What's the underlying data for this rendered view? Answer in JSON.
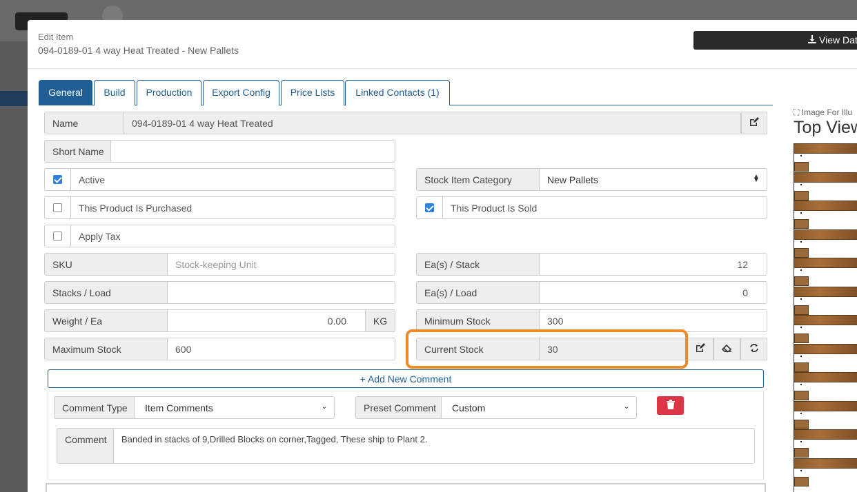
{
  "modal": {
    "subtitle": "Edit Item",
    "title": "094-0189-01 4 way Heat Treated - New Pallets",
    "view_button": "View Dat"
  },
  "tabs": [
    {
      "label": "General",
      "active": true
    },
    {
      "label": "Build"
    },
    {
      "label": "Production"
    },
    {
      "label": "Export Config"
    },
    {
      "label": "Price Lists"
    },
    {
      "label": "Linked Contacts (1)"
    }
  ],
  "form": {
    "name": {
      "label": "Name",
      "value": "094-0189-01 4 way Heat Treated"
    },
    "short_name": {
      "label": "Short Name",
      "value": ""
    },
    "active": {
      "label": "Active",
      "checked": true
    },
    "purchased": {
      "label": "This Product Is Purchased",
      "checked": false
    },
    "apply_tax": {
      "label": "Apply Tax",
      "checked": false
    },
    "stock_category": {
      "label": "Stock Item Category",
      "value": "New Pallets"
    },
    "sold": {
      "label": "This Product Is Sold",
      "checked": true
    },
    "sku": {
      "label": "SKU",
      "placeholder": "Stock-keeping Unit"
    },
    "stacks_load": {
      "label": "Stacks / Load",
      "value": ""
    },
    "weight_ea": {
      "label": "Weight / Ea",
      "value": "0.00",
      "unit": "KG"
    },
    "max_stock": {
      "label": "Maximum Stock",
      "value": "600"
    },
    "ea_stack": {
      "label": "Ea(s) / Stack",
      "value": "12"
    },
    "ea_load": {
      "label": "Ea(s) / Load",
      "value": "0"
    },
    "min_stock": {
      "label": "Minimum Stock",
      "value": "300"
    },
    "current_stock": {
      "label": "Current Stock",
      "value": "30"
    }
  },
  "comments": {
    "add_label": "+ Add New Comment",
    "type_label": "Comment Type",
    "type_value": "Item Comments",
    "preset_label": "Preset Comment",
    "preset_value": "Custom",
    "comment_label": "Comment",
    "comment_text": "Banded in stacks of 9,Drilled Blocks on corner,Tagged, These ship to Plant 2."
  },
  "image": {
    "caption": "Image For Illu",
    "title": "Top View"
  },
  "colors": {
    "primary": "#1f5f96",
    "highlight": "#ef8a2a",
    "danger": "#dc3545"
  }
}
